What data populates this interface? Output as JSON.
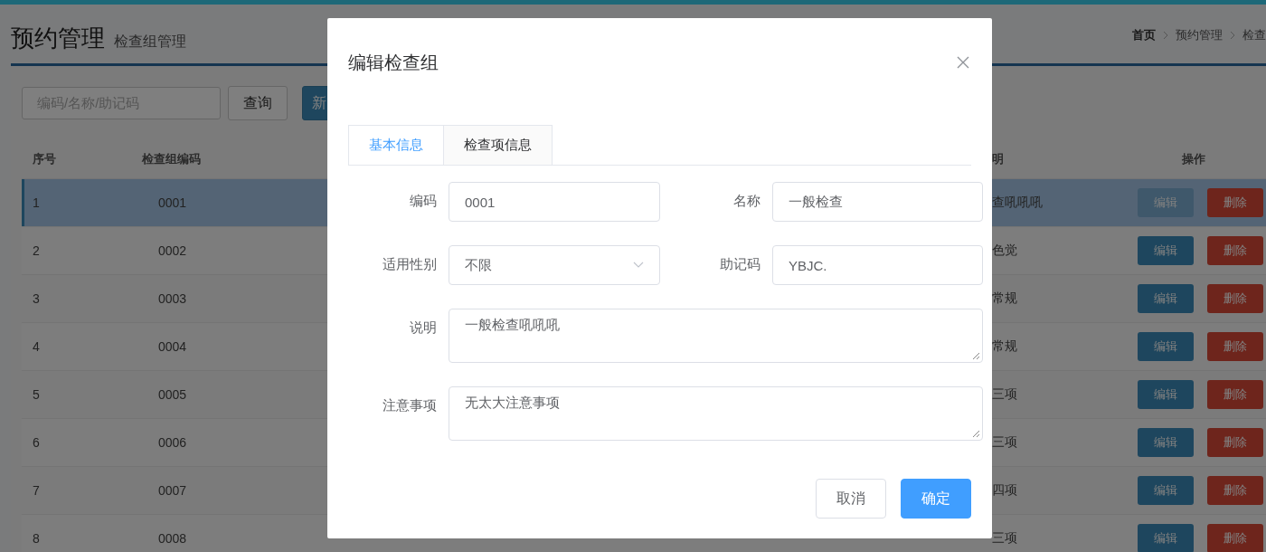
{
  "header": {
    "title": "预约管理",
    "subtitle": "检查组管理",
    "breadcrumb": [
      "首页",
      "预约管理",
      "检查"
    ]
  },
  "toolbar": {
    "search": {
      "placeholder": "编码/名称/助记码"
    },
    "buttons": [
      {
        "label": "查询",
        "kind": "default"
      },
      {
        "label": "新",
        "kind": "primary"
      }
    ]
  },
  "table": {
    "columns": [
      "序号",
      "检查组编码",
      "明",
      "操作"
    ],
    "rows": [
      {
        "index": "1",
        "code": "0001",
        "desc": "查吼吼吼",
        "actions": [
          "编辑",
          "删除"
        ],
        "selected": true
      },
      {
        "index": "2",
        "code": "0002",
        "desc": "色觉",
        "actions": [
          "编辑",
          "删除"
        ],
        "selected": false
      },
      {
        "index": "3",
        "code": "0003",
        "desc": "常规",
        "actions": [
          "编辑",
          "删除"
        ],
        "selected": false
      },
      {
        "index": "4",
        "code": "0004",
        "desc": "常规",
        "actions": [
          "编辑",
          "删除"
        ],
        "selected": false
      },
      {
        "index": "5",
        "code": "0005",
        "desc": "三项",
        "actions": [
          "编辑",
          "删除"
        ],
        "selected": false
      },
      {
        "index": "6",
        "code": "0006",
        "desc": "三项",
        "actions": [
          "编辑",
          "删除"
        ],
        "selected": false
      },
      {
        "index": "7",
        "code": "0007",
        "desc": "四项",
        "actions": [
          "编辑",
          "删除"
        ],
        "selected": false
      },
      {
        "index": "8",
        "code": "0008",
        "desc": "三项",
        "actions": [
          "编辑",
          "删除"
        ],
        "selected": false
      }
    ]
  },
  "dialog": {
    "title": "编辑检查组",
    "tabs": [
      {
        "label": "基本信息",
        "selected": true
      },
      {
        "label": "检查项信息",
        "selected": false
      }
    ],
    "fields": [
      {
        "label": "编码",
        "kind": "input",
        "value": "0001"
      },
      {
        "label": "名称",
        "kind": "input",
        "value": "一般检查"
      },
      {
        "label": "适用性别",
        "kind": "select",
        "value": "不限"
      },
      {
        "label": "助记码",
        "kind": "input",
        "value": "YBJC."
      },
      {
        "label": "说明",
        "kind": "textarea",
        "value": "一般检查吼吼吼"
      },
      {
        "label": "注意事项",
        "kind": "textarea",
        "value": "无太大注意事项"
      }
    ],
    "buttons": [
      {
        "label": "取消",
        "kind": "default"
      },
      {
        "label": "确定",
        "kind": "primary"
      }
    ]
  }
}
